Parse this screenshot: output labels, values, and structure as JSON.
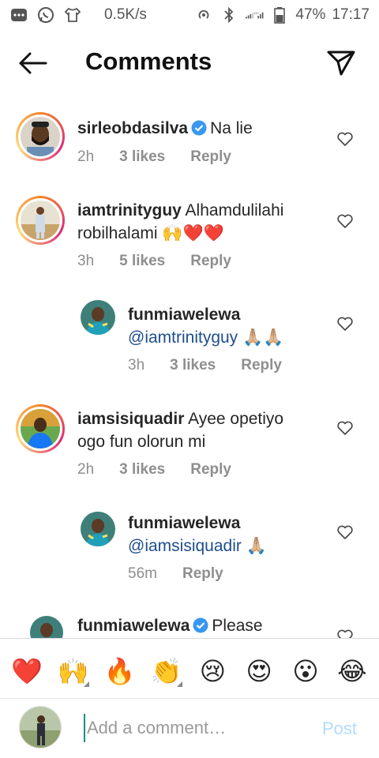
{
  "statusbar": {
    "speed": "0.5K/s",
    "battery": "47%",
    "time": "17:17"
  },
  "header": {
    "title": "Comments"
  },
  "comments": [
    {
      "username": "sirleobdasilva",
      "verified": true,
      "text": "Na lie",
      "time": "2h",
      "likes": "3 likes",
      "reply": "Reply"
    },
    {
      "username": "iamtrinityguy",
      "verified": false,
      "text": "Alhamdulilahi robilhalami 🙌❤️❤️",
      "time": "3h",
      "likes": "5 likes",
      "reply": "Reply"
    },
    {
      "username": "funmiawelewa",
      "verified": false,
      "mention": "@iamtrinityguy",
      "text": "🙏🏼🙏🏼",
      "time": "3h",
      "likes": "3 likes",
      "reply": "Reply"
    },
    {
      "username": "iamsisiquadir",
      "verified": false,
      "text": "Ayee opetiyo ogo fun olorun mi",
      "time": "2h",
      "likes": "3 likes",
      "reply": "Reply"
    },
    {
      "username": "funmiawelewa",
      "verified": false,
      "mention": "@iamsisiquadir",
      "text": "🙏🏼",
      "time": "56m",
      "reply": "Reply"
    },
    {
      "username": "funmiawelewa",
      "verified": true,
      "text": "Please"
    }
  ],
  "emoji_bar": [
    "❤️",
    "🙌",
    "🔥",
    "👏",
    "😢",
    "😍",
    "😮",
    "😂"
  ],
  "input": {
    "placeholder": "Add a comment…",
    "post_label": "Post"
  },
  "colors": {
    "mention": "#1f4e8c",
    "verified": "#3897f0",
    "meta": "#8e8e8e",
    "post_disabled": "#b3dbff"
  }
}
